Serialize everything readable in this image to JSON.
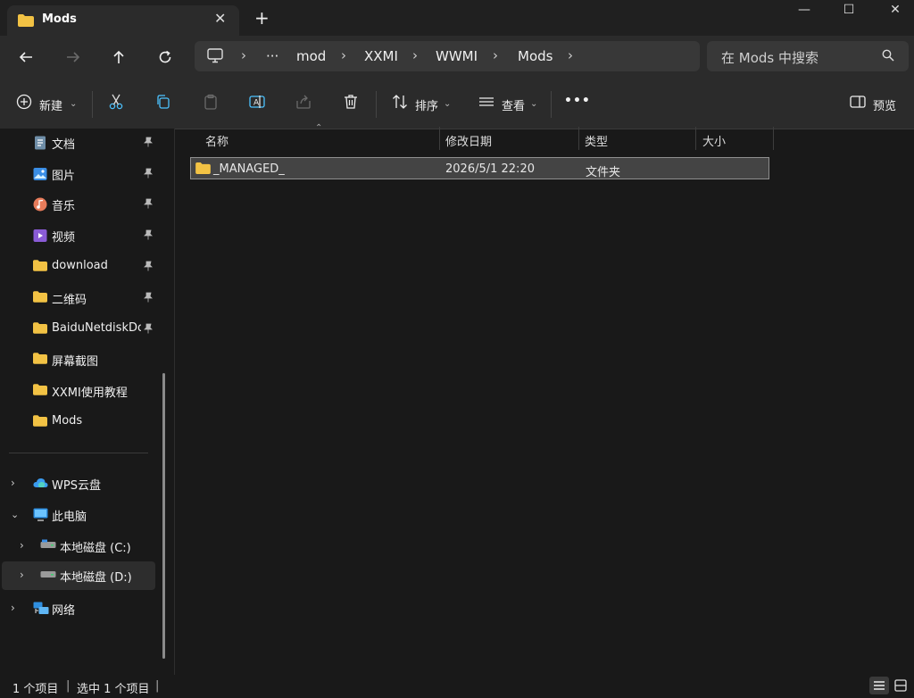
{
  "window": {
    "tab_title": "Mods",
    "tab_close": "✕",
    "new_tab": "+",
    "minimize": "—",
    "maximize": "☐",
    "close": "✕"
  },
  "nav": {
    "breadcrumb_more": "···",
    "breadcrumbs": [
      "mod",
      "XXMI",
      "WWMI",
      "Mods"
    ],
    "search_placeholder": "在 Mods 中搜索"
  },
  "toolbar": {
    "new_label": "新建",
    "sort_label": "排序",
    "view_label": "查看",
    "more_label": "•••",
    "preview_label": "预览"
  },
  "sidebar": {
    "quick_access": [
      {
        "label": "文档",
        "icon": "documents-icon"
      },
      {
        "label": "图片",
        "icon": "pictures-icon"
      },
      {
        "label": "音乐",
        "icon": "music-icon"
      },
      {
        "label": "视频",
        "icon": "videos-icon"
      },
      {
        "label": "download",
        "icon": "folder-icon"
      },
      {
        "label": "二维码",
        "icon": "folder-icon"
      },
      {
        "label": "BaiduNetdiskDownload",
        "icon": "folder-icon"
      },
      {
        "label": "屏幕截图",
        "icon": "folder-icon"
      },
      {
        "label": "XXMI使用教程",
        "icon": "folder-icon"
      },
      {
        "label": "Mods",
        "icon": "folder-icon"
      }
    ],
    "tree": [
      {
        "label": "WPS云盘",
        "icon": "cloud-icon",
        "expanded": false
      },
      {
        "label": "此电脑",
        "icon": "computer-icon",
        "expanded": true
      },
      {
        "label": "本地磁盘 (C:)",
        "icon": "drive-icon",
        "expanded": false
      },
      {
        "label": "本地磁盘 (D:)",
        "icon": "drive-icon",
        "expanded": false,
        "selected": true
      },
      {
        "label": "网络",
        "icon": "network-icon",
        "expanded": false
      }
    ]
  },
  "files": {
    "columns": [
      "名称",
      "修改日期",
      "类型",
      "大小"
    ],
    "rows": [
      {
        "name": "_MANAGED_",
        "modified": "2026/5/1 22:20",
        "type": "文件夹",
        "size": ""
      }
    ]
  },
  "status": {
    "item_count": "1 个项目",
    "selected_count": "选中 1 个项目",
    "divider": "|"
  },
  "colors": {
    "folder": "#f2c244",
    "accent": "#4cc2ff",
    "background": "#191919",
    "panel": "#2b2b2b"
  }
}
